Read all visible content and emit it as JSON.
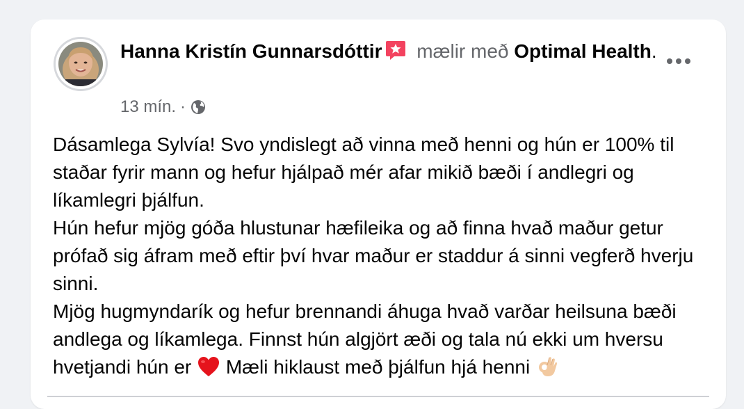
{
  "post": {
    "author": "Hanna Kristín Gunnarsdóttir",
    "action": "mælir með",
    "page": "Optimal Health",
    "period": ".",
    "timestamp": "13 mín.",
    "separator": "·",
    "audience_icon": "globe-icon",
    "badge_icon": "recommend-star-icon",
    "menu_icon": "more-options-icon",
    "paragraph1": "Dásamlega Sylvía! Svo yndislegt að vinna með henni og hún er 100% til staðar fyrir mann og hefur hjálpað mér afar mikið bæði í andlegri og líkamlegri þjálfun.",
    "paragraph2": "Hún hefur mjög góða hlustunar hæfileika og að finna hvað maður getur prófað sig áfram með eftir því hvar maður er staddur á sinni vegferð hverju sinni.",
    "paragraph3_part1": "Mjög hugmyndarík og hefur brennandi áhuga hvað varðar heilsuna bæði andlega og líkamlega. Finnst hún algjört æði og tala nú ekki um hversu hvetjandi hún er",
    "paragraph3_part2": "Mæli hiklaust með þjálfun hjá henni",
    "emoji1": "red-heart-icon",
    "emoji2": "ok-hand-icon"
  },
  "colors": {
    "background": "#f0f2f5",
    "card": "#ffffff",
    "primary_text": "#050505",
    "secondary_text": "#65676b",
    "badge": "#f3425f"
  }
}
